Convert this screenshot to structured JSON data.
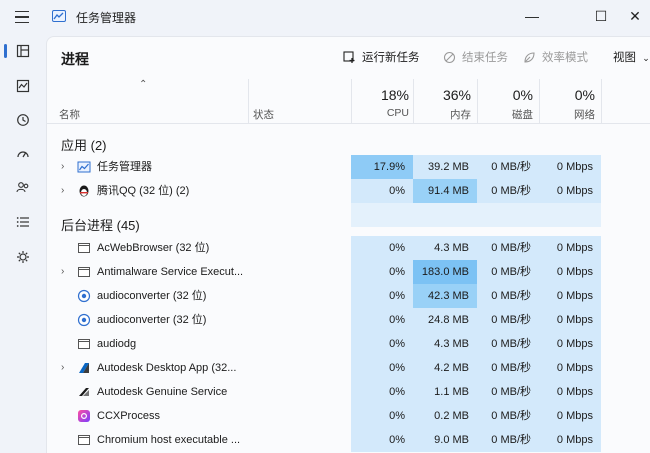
{
  "window": {
    "title": "任务管理器",
    "minimize_glyph": "—",
    "maximize_glyph": "☐",
    "close_glyph": "✕"
  },
  "nav": {
    "items": [
      "processes-icon",
      "performance-icon",
      "app-history-icon",
      "startup-icon",
      "users-icon",
      "details-icon",
      "services-icon"
    ]
  },
  "page": {
    "title": "进程",
    "toolbar": {
      "run_new_task": "运行新任务",
      "end_task": "结束任务",
      "efficiency_mode": "效率模式",
      "view": "视图"
    }
  },
  "table": {
    "columns": {
      "name": "名称",
      "status": "状态",
      "cpu": {
        "pct": "18%",
        "label": "CPU"
      },
      "memory": {
        "pct": "36%",
        "label": "内存"
      },
      "disk": {
        "pct": "0%",
        "label": "磁盘"
      },
      "network": {
        "pct": "0%",
        "label": "网络"
      }
    },
    "groups": [
      {
        "title": "应用 (2)",
        "rows": [
          {
            "name": "任务管理器",
            "cpu": "17.9%",
            "mem": "39.2 MB",
            "disk": "0 MB/秒",
            "net": "0 Mbps"
          },
          {
            "name": "腾讯QQ (32 位) (2)",
            "cpu": "0%",
            "mem": "91.4 MB",
            "disk": "0 MB/秒",
            "net": "0 Mbps"
          }
        ]
      },
      {
        "title": "后台进程 (45)",
        "rows": [
          {
            "name": "AcWebBrowser (32 位)",
            "cpu": "0%",
            "mem": "4.3 MB",
            "disk": "0 MB/秒",
            "net": "0 Mbps"
          },
          {
            "name": "Antimalware Service Execut...",
            "cpu": "0%",
            "mem": "183.0 MB",
            "disk": "0 MB/秒",
            "net": "0 Mbps"
          },
          {
            "name": "audioconverter (32 位)",
            "cpu": "0%",
            "mem": "42.3 MB",
            "disk": "0 MB/秒",
            "net": "0 Mbps"
          },
          {
            "name": "audioconverter (32 位)",
            "cpu": "0%",
            "mem": "24.8 MB",
            "disk": "0 MB/秒",
            "net": "0 Mbps"
          },
          {
            "name": "audiodg",
            "cpu": "0%",
            "mem": "4.3 MB",
            "disk": "0 MB/秒",
            "net": "0 Mbps"
          },
          {
            "name": "Autodesk Desktop App (32...",
            "cpu": "0%",
            "mem": "4.2 MB",
            "disk": "0 MB/秒",
            "net": "0 Mbps"
          },
          {
            "name": "Autodesk Genuine Service",
            "cpu": "0%",
            "mem": "1.1 MB",
            "disk": "0 MB/秒",
            "net": "0 Mbps"
          },
          {
            "name": "CCXProcess",
            "cpu": "0%",
            "mem": "0.2 MB",
            "disk": "0 MB/秒",
            "net": "0 Mbps"
          },
          {
            "name": "Chromium host executable ...",
            "cpu": "0%",
            "mem": "9.0 MB",
            "disk": "0 MB/秒",
            "net": "0 Mbps"
          }
        ]
      }
    ]
  },
  "colors": {
    "accent": "#2f6fcf",
    "heat_light": "#d3e9fb",
    "heat_strong": "#99d1f7"
  }
}
